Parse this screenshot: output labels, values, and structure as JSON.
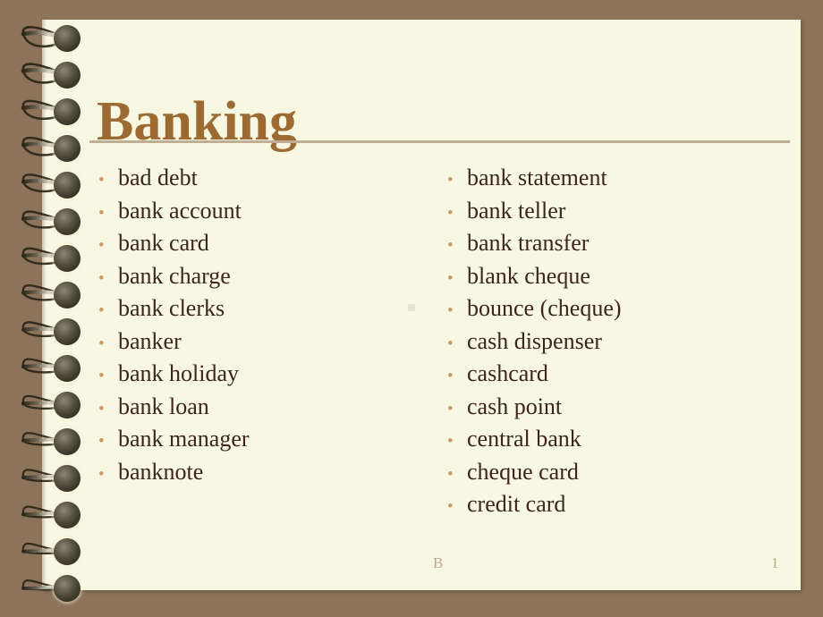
{
  "slide": {
    "title": "Banking",
    "bullet_glyph": "•",
    "columns": {
      "left": [
        "bad debt",
        "bank account",
        "bank card",
        "bank charge",
        "bank clerks",
        "banker",
        "bank holiday",
        "bank loan",
        "bank manager",
        "banknote"
      ],
      "right": [
        "bank statement",
        "bank teller",
        "bank transfer",
        "blank cheque",
        "bounce (cheque)",
        "cash dispenser",
        "cashcard",
        "cash point",
        "central bank",
        "cheque card",
        "credit card"
      ]
    },
    "footer": {
      "left": "B",
      "right": "1"
    },
    "colors": {
      "background": "#8c7359",
      "paper": "#f8f8e2",
      "title": "#9c6b33",
      "rule": "#bfae93",
      "body_text": "#3b2618",
      "bullet": "#c8986a",
      "footer_text": "#bba98e"
    }
  }
}
